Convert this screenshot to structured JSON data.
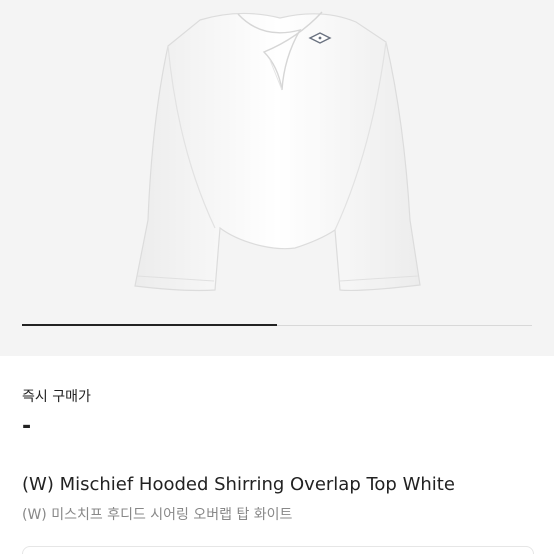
{
  "product": {
    "image_label": "white long-sleeve shirring overlap top",
    "carousel_progress": 0.5
  },
  "price_section": {
    "label": "즉시 구매가",
    "value": "-"
  },
  "titles": {
    "english": "(W) Mischief Hooded Shirring Overlap Top White",
    "korean": "(W) 미스치프 후디드 시어링 오버랩 탑 화이트"
  }
}
